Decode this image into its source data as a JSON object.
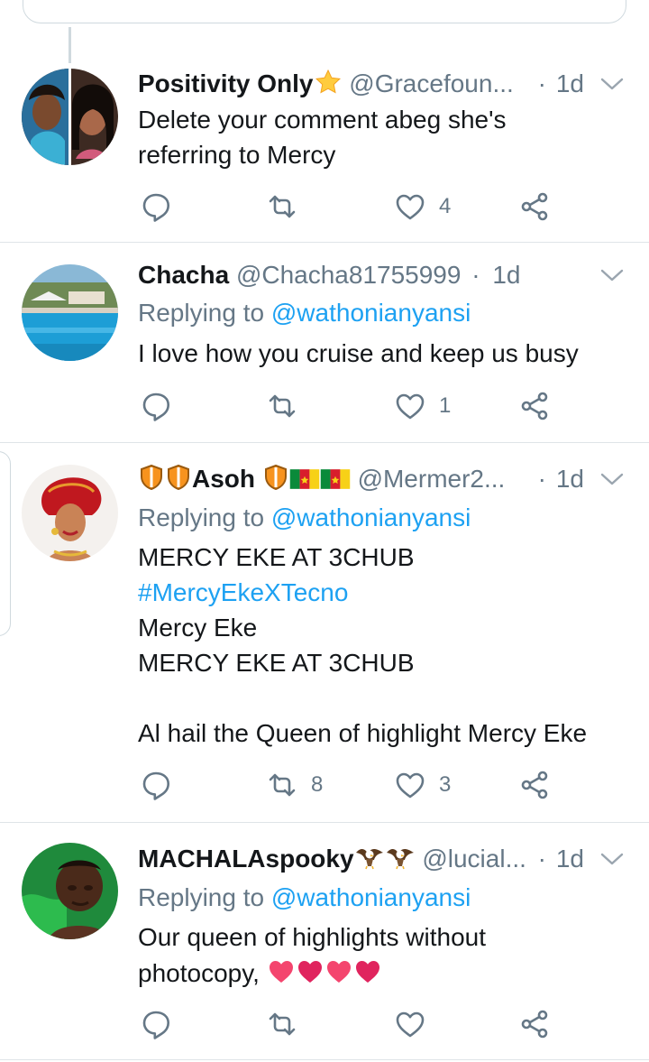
{
  "colors": {
    "link": "#1da1f2",
    "muted": "#657786",
    "text": "#14171a",
    "divider": "#dfe4e8"
  },
  "tweets": [
    {
      "name": "Positivity Only",
      "name_emoji": "star",
      "handle": "@Gracefoun...",
      "dot": "·",
      "time": "1d",
      "lines": [
        "Delete your comment abeg she's",
        "referring to Mercy"
      ],
      "replies": "",
      "retweets": "",
      "likes": "4"
    },
    {
      "name": "Chacha",
      "handle": "@Chacha81755999",
      "dot": "·",
      "time": "1d",
      "replying_prefix": "Replying to ",
      "replying_to": "@wathonianyansi",
      "lines": [
        "I love how you cruise and keep us busy"
      ],
      "replies": "",
      "retweets": "",
      "likes": "1"
    },
    {
      "name": "Asoh",
      "name_emojis": [
        "shield",
        "shield",
        "shield",
        "flag-cameroon",
        "flag-cameroon"
      ],
      "handle": "@Mermer2...",
      "dot": "·",
      "time": "1d",
      "replying_prefix": "Replying to ",
      "replying_to": "@wathonianyansi",
      "lines": [
        "MERCY EKE AT 3CHUB",
        "#MercyEkeXTecno",
        "Mercy Eke",
        "MERCY EKE AT 3CHUB",
        "",
        "Al hail the Queen of highlight Mercy Eke"
      ],
      "replies": "",
      "retweets": "8",
      "likes": "3"
    },
    {
      "name": "MACHALAspooky",
      "name_emojis": [
        "eagle",
        "eagle"
      ],
      "handle": "@lucial...",
      "dot": "·",
      "time": "1d",
      "replying_prefix": "Replying to ",
      "replying_to": "@wathonianyansi",
      "lines": [
        "Our queen of highlights without",
        "photocopy,"
      ],
      "trailing_emojis": [
        "revolving-hearts",
        "sparkling-heart",
        "two-hearts",
        "beating-heart"
      ],
      "replies": "",
      "retweets": "",
      "likes": ""
    }
  ]
}
